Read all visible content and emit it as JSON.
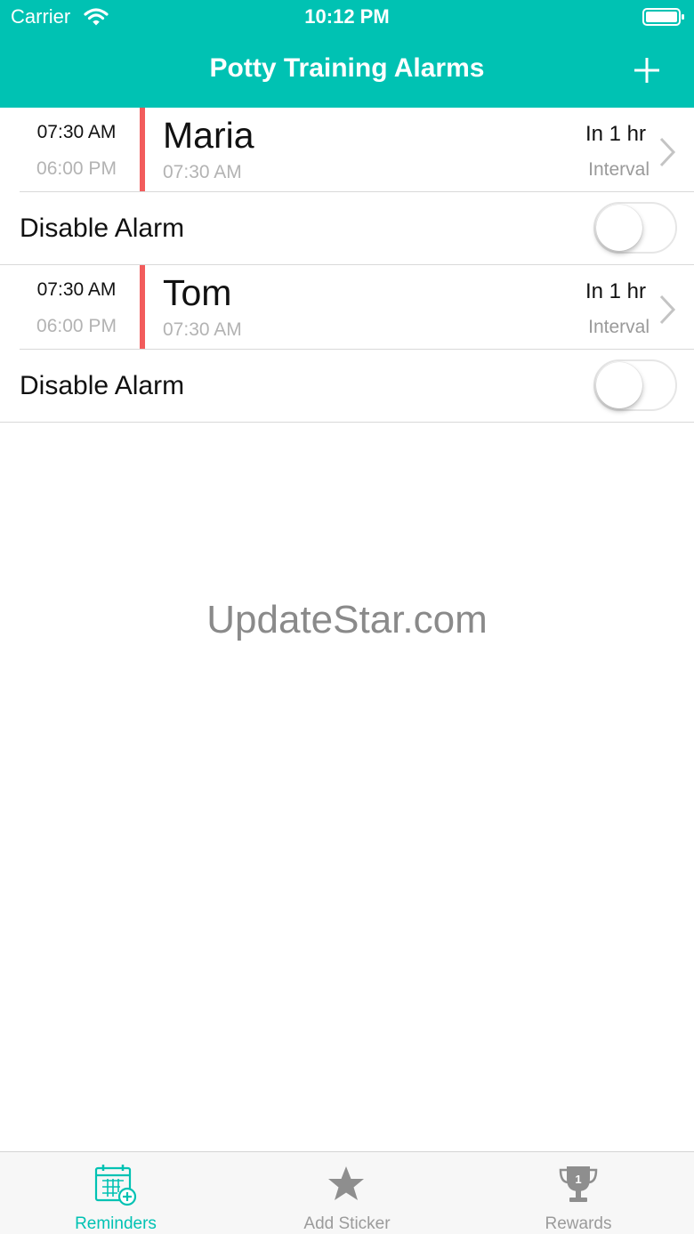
{
  "status_bar": {
    "carrier": "Carrier",
    "time": "10:12 PM"
  },
  "nav": {
    "title": "Potty Training Alarms",
    "add_icon": "plus-icon"
  },
  "colors": {
    "accent": "#00c2b3",
    "alarm_marker": "#f25c5c",
    "tab_inactive": "#9b9b9b"
  },
  "alarms": [
    {
      "start_time": "07:30 AM",
      "end_time": "06:00 PM",
      "name": "Maria",
      "next_time": "07:30 AM",
      "countdown": "In 1 hr",
      "mode": "Interval",
      "toggle_label": "Disable Alarm",
      "disabled": false
    },
    {
      "start_time": "07:30 AM",
      "end_time": "06:00 PM",
      "name": "Tom",
      "next_time": "07:30 AM",
      "countdown": "In 1 hr",
      "mode": "Interval",
      "toggle_label": "Disable Alarm",
      "disabled": false
    }
  ],
  "watermark": "UpdateStar.com",
  "tabs": [
    {
      "label": "Reminders",
      "icon": "calendar-add-icon",
      "selected": true
    },
    {
      "label": "Add Sticker",
      "icon": "star-icon",
      "selected": false
    },
    {
      "label": "Rewards",
      "icon": "trophy-icon",
      "selected": false
    }
  ]
}
